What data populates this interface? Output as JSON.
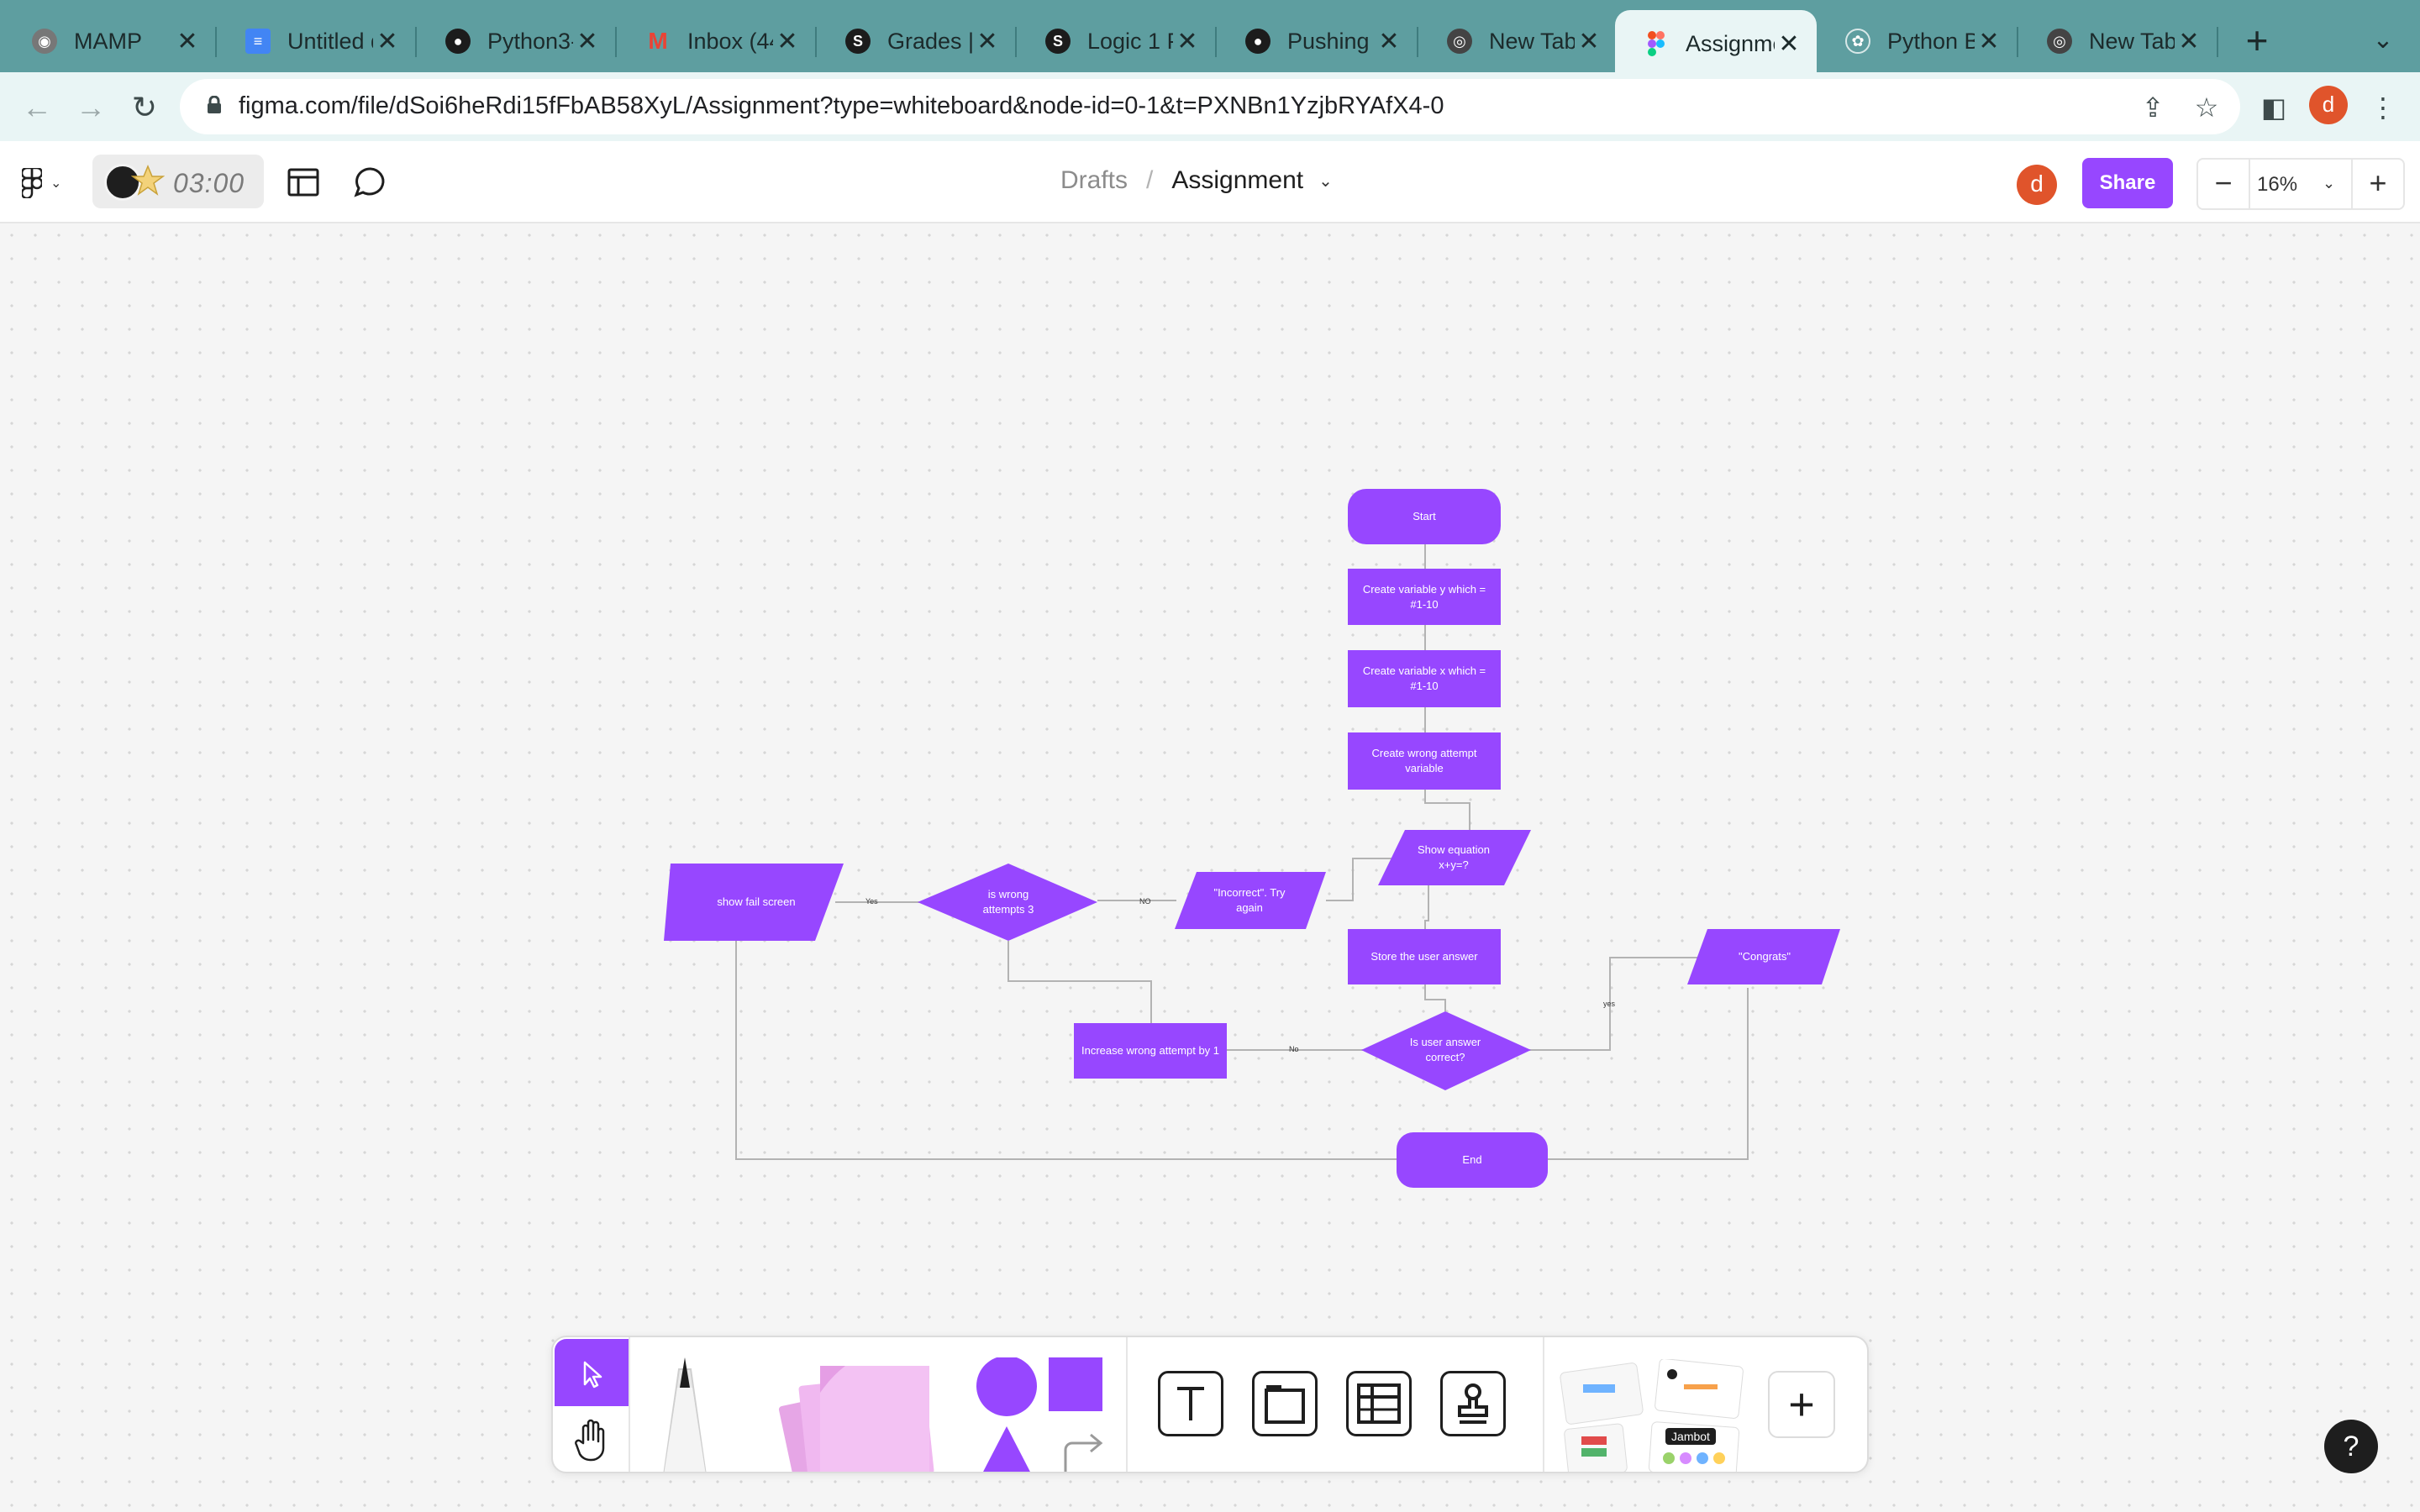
{
  "browser": {
    "tabs": [
      {
        "title": "MAMP",
        "icon": "mamp-icon",
        "color": "#555555"
      },
      {
        "title": "Untitled d",
        "icon": "google-docs-icon",
        "color": "#4285f4"
      },
      {
        "title": "Python3-",
        "icon": "github-icon",
        "color": "#1c1c1c"
      },
      {
        "title": "Inbox (44",
        "icon": "gmail-icon",
        "color": "#ea4335"
      },
      {
        "title": "Grades | ",
        "icon": "schoology-icon",
        "color": "#1c1c1c"
      },
      {
        "title": "Logic 1 P",
        "icon": "schoology-icon",
        "color": "#1c1c1c"
      },
      {
        "title": "Pushing ",
        "icon": "github-icon",
        "color": "#1c1c1c"
      },
      {
        "title": "New Tab",
        "icon": "chrome-icon",
        "color": "#444444"
      },
      {
        "title": "Assignme",
        "icon": "figma-icon",
        "color": "#f24e1e",
        "active": true
      },
      {
        "title": "Python B",
        "icon": "openai-icon",
        "color": "#555555"
      },
      {
        "title": "New Tab",
        "icon": "chrome-icon",
        "color": "#444444"
      }
    ],
    "url": "figma.com/file/dSoi6heRdi15fFbAB58XyL/Assignment?type=whiteboard&node-id=0-1&t=PXNBn1YzjbRYAfX4-0",
    "profile_initial": "d"
  },
  "figma": {
    "timer": "03:00",
    "breadcrumb_parent": "Drafts",
    "breadcrumb_separator": "/",
    "file_name": "Assignment",
    "user_initial": "d",
    "share_label": "Share",
    "zoom": "16%",
    "accent_color": "#9747ff"
  },
  "flowchart": {
    "node_color": "#9747ff",
    "nodes": {
      "start": "Start",
      "create_y": "Create variable y which = #1-10",
      "create_x": "Create variable x which = #1-10",
      "create_wrong": "Create wrong attempt variable",
      "show_equation": "Show equation x+y=?",
      "incorrect": "\"Incorrect\". Try again",
      "wrong_attempts": "is wrong attempts 3",
      "fail_screen": "show fail screen",
      "store_answer": "Store the user answer",
      "is_correct": "Is user answer correct?",
      "increase_wrong": "Increase wrong attempt by 1",
      "congrats": "\"Congrats\"",
      "end": "End"
    },
    "edge_labels": {
      "yes_fail": "Yes",
      "no_wrong": "NO",
      "no_correct": "No",
      "yes_correct": "yes"
    }
  },
  "help_label": "?"
}
